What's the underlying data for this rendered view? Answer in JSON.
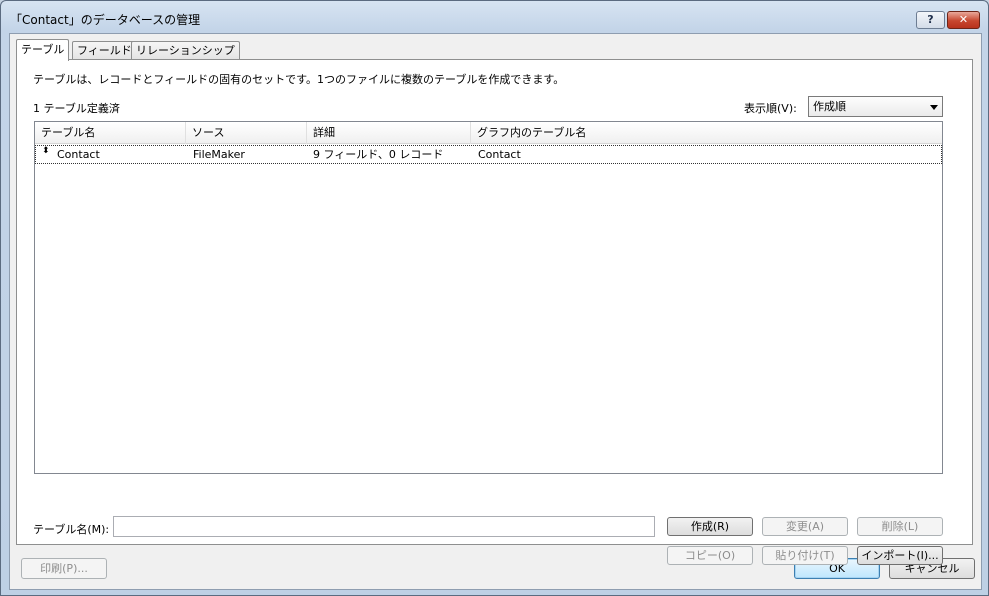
{
  "window": {
    "title": "「Contact」のデータベースの管理",
    "help_label": "?",
    "close_label": "✕"
  },
  "tabs": [
    {
      "label": "テーブル",
      "active": true
    },
    {
      "label": "フィールド",
      "active": false
    },
    {
      "label": "リレーションシップ",
      "active": false
    }
  ],
  "panel": {
    "description": "テーブルは、レコードとフィールドの固有のセットです。1つのファイルに複数のテーブルを作成できます。",
    "count_label": "1 テーブル定義済",
    "sort_label": "表示順(V):",
    "sort_value": "作成順"
  },
  "table": {
    "columns": [
      "テーブル名",
      "ソース",
      "詳細",
      "グラフ内のテーブル名"
    ],
    "rows": [
      {
        "grip": "⬍",
        "name": "Contact",
        "source": "FileMaker",
        "details": "9 フィールド、0 レコード",
        "graph_name": "Contact"
      }
    ]
  },
  "form": {
    "name_label": "テーブル名(M):",
    "name_value": "",
    "create_label": "作成(R)",
    "change_label": "変更(A)",
    "delete_label": "削除(L)",
    "copy_label": "コピー(O)",
    "paste_label": "貼り付け(T)",
    "import_label": "インポート(I)..."
  },
  "footer": {
    "print_label": "印刷(P)...",
    "ok_label": "OK",
    "cancel_label": "キャンセル"
  }
}
